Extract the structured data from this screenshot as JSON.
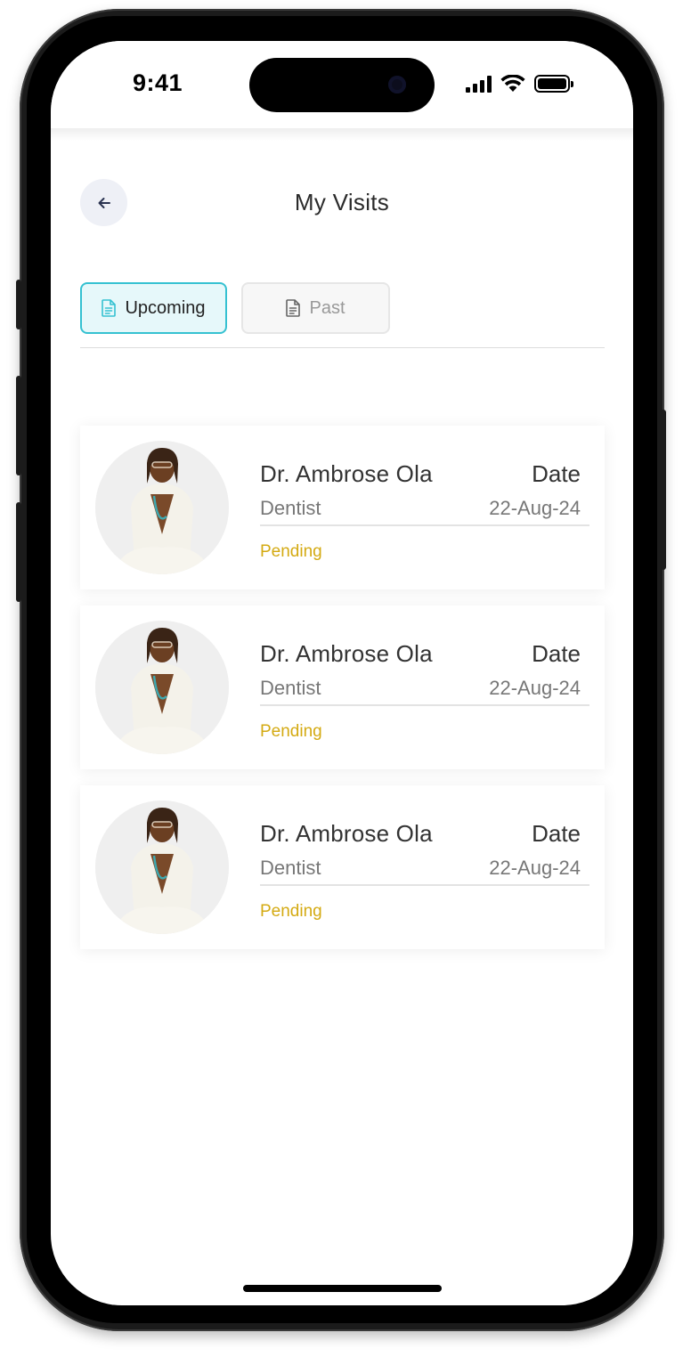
{
  "status_bar": {
    "time": "9:41"
  },
  "header": {
    "title": "My Visits",
    "back_icon": "arrow-left-icon"
  },
  "tabs": [
    {
      "label": "Upcoming",
      "icon": "document-icon",
      "active": true
    },
    {
      "label": "Past",
      "icon": "document-icon",
      "active": false
    }
  ],
  "visits": [
    {
      "doctor": "Dr. Ambrose Ola",
      "specialty": "Dentist",
      "date_label": "Date",
      "date": "22-Aug-24",
      "status": "Pending"
    },
    {
      "doctor": "Dr. Ambrose Ola",
      "specialty": "Dentist",
      "date_label": "Date",
      "date": "22-Aug-24",
      "status": "Pending"
    },
    {
      "doctor": "Dr. Ambrose Ola",
      "specialty": "Dentist",
      "date_label": "Date",
      "date": "22-Aug-24",
      "status": "Pending"
    }
  ],
  "colors": {
    "accent": "#35c1d1",
    "active_tab_bg": "#e6f8fa",
    "pending": "#d4aa12",
    "text_dark": "#333333",
    "text_muted": "#777777"
  }
}
